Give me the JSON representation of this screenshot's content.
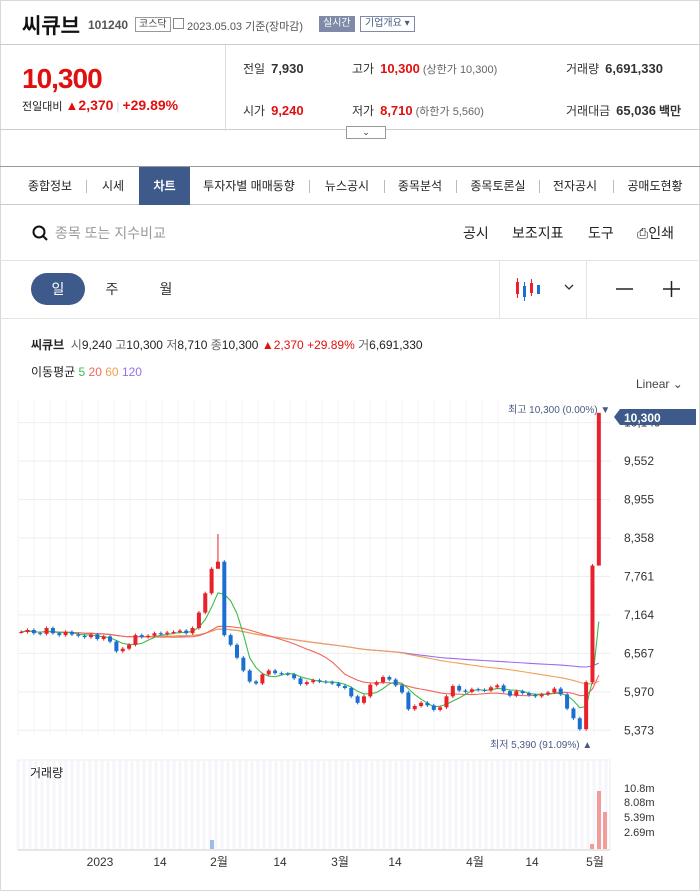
{
  "header": {
    "name": "씨큐브",
    "code": "101240",
    "market": "코스닥",
    "date": "2023.05.03 기준(장마감)",
    "realtime": "실시간",
    "company": "기업개요"
  },
  "quote": {
    "price": "10,300",
    "change_label": "전일대비",
    "change": "2,370",
    "change_pct": "+29.89%",
    "prev_label": "전일",
    "prev": "7,930",
    "high_label": "고가",
    "high": "10,300",
    "upper_limit": "(상한가 10,300)",
    "volume_label": "거래량",
    "volume": "6,691,330",
    "open_label": "시가",
    "open": "9,240",
    "low_label": "저가",
    "low": "8,710",
    "lower_limit": "(하한가 5,560)",
    "amount_label": "거래대금",
    "amount": "65,036",
    "amount_unit": "백만"
  },
  "tabs": [
    "종합정보",
    "시세",
    "차트",
    "투자자별 매매동향",
    "뉴스공시",
    "종목분석",
    "종목토론실",
    "전자공시",
    "공매도현황"
  ],
  "toolbar": {
    "search_placeholder": "종목 또는 지수비교",
    "disclosure": "공시",
    "indicator": "보조지표",
    "tools": "도구",
    "print": "인쇄"
  },
  "periods": [
    "일",
    "주",
    "월"
  ],
  "legend": {
    "name": "씨큐브",
    "open_label": "시",
    "open": "9,240",
    "high_label": "고",
    "high": "10,300",
    "low_label": "저",
    "low": "8,710",
    "close_label": "종",
    "close": "10,300",
    "change": "▲2,370 +29.89%",
    "vol_label": "거",
    "vol": "6,691,330"
  },
  "ma": {
    "label": "이동평균",
    "p5": "5",
    "p20": "20",
    "p60": "60",
    "p120": "120"
  },
  "scale": "Linear",
  "chart_data": {
    "type": "candlestick",
    "y_ticks": [
      "10,149",
      "9,552",
      "8,955",
      "8,358",
      "7,761",
      "7,164",
      "6,567",
      "5,970",
      "5,373"
    ],
    "x_ticks": [
      "2023",
      "14",
      "2월",
      "14",
      "3월",
      "14",
      "4월",
      "14",
      "5월"
    ],
    "last_price": "10,300",
    "max_label": "최고 10,300 (0.00%)",
    "min_label": "최저 5,390 (91.09%)",
    "volume_title": "거래량",
    "volume_ticks": [
      "10.8m",
      "8.08m",
      "5.39m",
      "2.69m"
    ],
    "colors": {
      "up": "#e8212a",
      "down": "#1a6fd1",
      "ma5": "#3dbb4a",
      "ma20": "#f2675a",
      "ma60": "#f0a152",
      "ma120": "#9a6cf0"
    },
    "closes": [
      6900,
      6930,
      6880,
      6870,
      6960,
      6880,
      6850,
      6900,
      6860,
      6840,
      6820,
      6860,
      6790,
      6830,
      6750,
      6600,
      6640,
      6700,
      6850,
      6820,
      6840,
      6880,
      6870,
      6890,
      6900,
      6920,
      6880,
      6960,
      7200,
      7500,
      7880,
      7990,
      6850,
      6700,
      6500,
      6300,
      6130,
      6100,
      6240,
      6300,
      6260,
      6250,
      6240,
      6180,
      6090,
      6120,
      6150,
      6130,
      6120,
      6100,
      6060,
      6030,
      5900,
      5800,
      5900,
      6080,
      6120,
      6200,
      6160,
      6070,
      5960,
      5700,
      5750,
      5800,
      5760,
      5690,
      5730,
      5900,
      6060,
      5990,
      5970,
      6010,
      6000,
      5990,
      6040,
      6070,
      5980,
      5910,
      5980,
      5950,
      5920,
      5900,
      5930,
      5960,
      6020,
      5930,
      5710,
      5560,
      5390,
      6120,
      7930,
      10300
    ]
  }
}
